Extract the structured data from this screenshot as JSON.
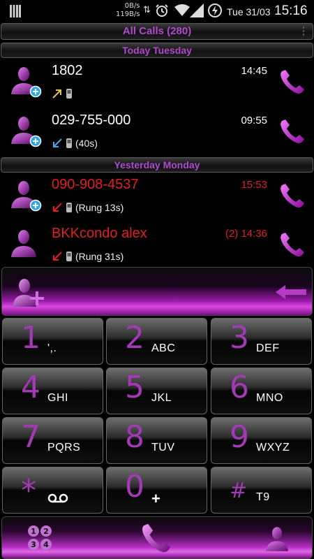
{
  "status_bar": {
    "speed_down": "0B/s",
    "speed_up": "119B/s",
    "date": "Tue 31/03",
    "time": "15:16"
  },
  "header": {
    "title": "All Calls (280)"
  },
  "sections": [
    {
      "label": "Today  Tuesday",
      "calls": [
        {
          "name": "1802",
          "time": "14:45",
          "direction": "outgoing",
          "detail": "",
          "color": "#ffffff"
        },
        {
          "name": "029-755-000",
          "time": "09:55",
          "direction": "incoming",
          "detail": "(40s)",
          "color": "#ffffff"
        }
      ]
    },
    {
      "label": "Yesterday  Monday",
      "calls": [
        {
          "name": "090-908-4537",
          "time": "15:53",
          "direction": "missed",
          "detail": "(Rung 13s)",
          "color": "#e02020"
        },
        {
          "name": "BKKcondo alex",
          "time": "(2) 14:36",
          "direction": "missed",
          "detail": "(Rung 31s)",
          "color": "#e02020"
        }
      ]
    }
  ],
  "keypad": [
    {
      "digit": "1",
      "letters": "',."
    },
    {
      "digit": "2",
      "letters": "ABC"
    },
    {
      "digit": "3",
      "letters": "DEF"
    },
    {
      "digit": "4",
      "letters": "GHI"
    },
    {
      "digit": "5",
      "letters": "JKL"
    },
    {
      "digit": "6",
      "letters": "MNO"
    },
    {
      "digit": "7",
      "letters": "PQRS"
    },
    {
      "digit": "8",
      "letters": "TUV"
    },
    {
      "digit": "9",
      "letters": "WXYZ"
    },
    {
      "digit": "*",
      "letters": ""
    },
    {
      "digit": "0",
      "letters": "+"
    },
    {
      "digit": "#",
      "letters": "T9"
    }
  ],
  "colors": {
    "accent": "#a23ab5",
    "missed": "#e02020",
    "outgoing_arrow": "#e8c060",
    "incoming_arrow": "#4aa8e8"
  }
}
